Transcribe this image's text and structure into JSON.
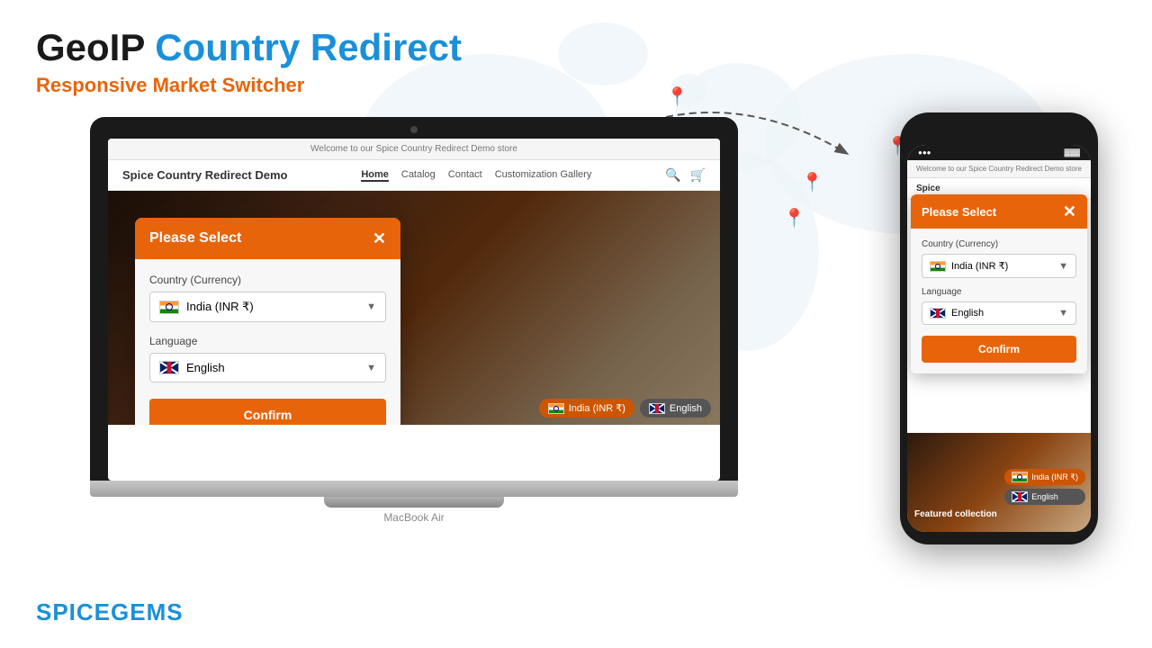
{
  "header": {
    "title_black": "GeoIP",
    "title_blue": " Country Redirect",
    "subtitle": "Responsive Market Switcher"
  },
  "branding": {
    "name": "SPICEGEMS"
  },
  "laptop": {
    "browser_topbar": "Welcome to our Spice Country Redirect Demo store",
    "store_name": "Spice Country Redirect Demo",
    "nav_links": [
      "Home",
      "Catalog",
      "Contact",
      "Customization Gallery"
    ],
    "model": "MacBook Air",
    "modal": {
      "title": "Please Select",
      "country_label": "Country (Currency)",
      "country_value": "India  (INR ₹)",
      "language_label": "Language",
      "language_value": "English",
      "confirm_btn": "Confirm"
    },
    "bottom_pills": [
      {
        "label": "India  (INR ₹)",
        "type": "orange"
      },
      {
        "label": "English",
        "type": "gray"
      }
    ]
  },
  "phone": {
    "topbar": "Welcome to our Spice Country Redirect Demo store",
    "store_name": "Spice",
    "modal": {
      "title": "Please Select",
      "country_label": "Country (Currency)",
      "country_value": "India  (INR ₹)",
      "language_label": "Language",
      "language_value": "English",
      "confirm_btn": "Confirm"
    },
    "bottom_pills": [
      {
        "label": "India  (INR ₹)",
        "type": "orange"
      },
      {
        "label": "English",
        "type": "gray"
      }
    ],
    "featured": "Featured collection"
  },
  "colors": {
    "orange": "#e8640a",
    "blue": "#1a90d9",
    "dark": "#1a1a1a"
  }
}
